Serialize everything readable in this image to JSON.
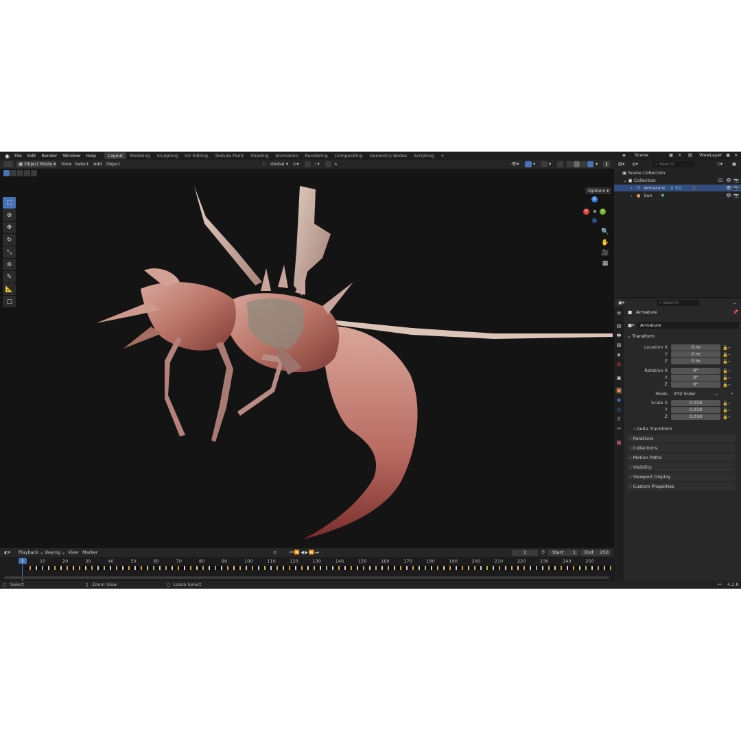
{
  "menu": [
    "File",
    "Edit",
    "Render",
    "Window",
    "Help"
  ],
  "workspaces": [
    {
      "label": "Layout",
      "active": true
    },
    {
      "label": "Modeling",
      "active": false
    },
    {
      "label": "Sculpting",
      "active": false
    },
    {
      "label": "UV Editing",
      "active": false
    },
    {
      "label": "Texture Paint",
      "active": false
    },
    {
      "label": "Shading",
      "active": false
    },
    {
      "label": "Animation",
      "active": false
    },
    {
      "label": "Rendering",
      "active": false
    },
    {
      "label": "Compositing",
      "active": false
    },
    {
      "label": "Geometry Nodes",
      "active": false
    },
    {
      "label": "Scripting",
      "active": false
    }
  ],
  "add_workspace_label": "+",
  "scene_label": "Scene",
  "view_layer_label": "ViewLayer",
  "viewport_header": {
    "mode": "Object Mode",
    "menus": [
      "View",
      "Select",
      "Add",
      "Object"
    ],
    "transform_orientation": "Global",
    "options_label": "Options"
  },
  "gizmo": {
    "x_label": "X",
    "y_label": "Y",
    "z_label": "Z"
  },
  "outliner": {
    "search_placeholder": "Search",
    "scene_collection": "Scene Collection",
    "collection": "Collection",
    "items": [
      "Armature",
      "Sun"
    ]
  },
  "properties": {
    "search_placeholder": "Search",
    "object_name": "Armature",
    "data_name": "Armature",
    "transform_title": "Transform",
    "location_label": "Location X",
    "location": [
      "0 m",
      "0 m",
      "0 m"
    ],
    "rotation_label": "Rotation X",
    "rotation": [
      "0°",
      "0°",
      "0°"
    ],
    "mode_label": "Mode",
    "mode_value": "XYZ Euler",
    "scale_label": "Scale X",
    "scale": [
      "0.010",
      "0.010",
      "0.010"
    ],
    "y_label": "Y",
    "z_label": "Z",
    "delta_transform": "Delta Transform",
    "panels": [
      "Relations",
      "Collections",
      "Motion Paths",
      "Visibility",
      "Viewport Display",
      "Custom Properties"
    ]
  },
  "timeline": {
    "menus": [
      "Playback",
      "Keying",
      "View",
      "Marker"
    ],
    "current_frame": "1",
    "start_label": "Start",
    "start_value": "1",
    "end_label": "End",
    "end_value": "250",
    "ticks": [
      "10",
      "20",
      "30",
      "40",
      "50",
      "60",
      "70",
      "80",
      "90",
      "100",
      "110",
      "120",
      "130",
      "140",
      "150",
      "160",
      "170",
      "180",
      "190",
      "200",
      "210",
      "220",
      "230",
      "240",
      "250"
    ],
    "playhead": "1"
  },
  "status_bar": {
    "select": "Select",
    "zoom": "Zoom View",
    "lasso": "Lasso Select",
    "version": "4.2.8"
  },
  "colors": {
    "accent": "#4772b3",
    "header": "#262626",
    "viewport": "#141414",
    "selected_row": "#334d80",
    "axis_x": "#e2433d",
    "axis_y": "#7ab32d",
    "axis_z": "#3d84e0"
  }
}
